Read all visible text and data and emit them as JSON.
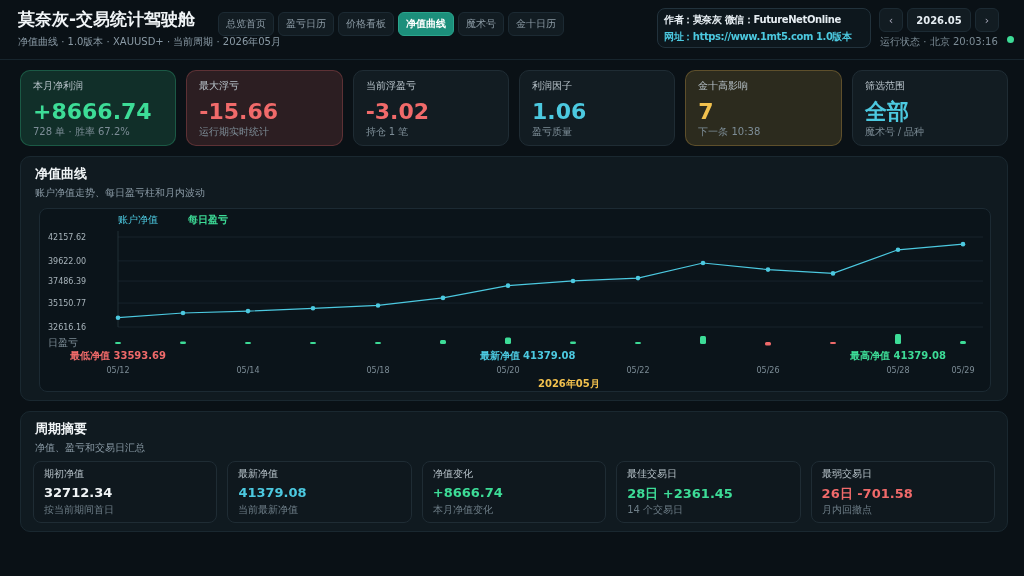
{
  "header": {
    "title": "莫奈灰-交易统计驾驶舱",
    "subtitle": "净值曲线 · 1.0版本 · XAUUSD+ · 当前周期 · 2026年05月",
    "tabs": [
      {
        "label": "总览首页",
        "selected": false
      },
      {
        "label": "盈亏日历",
        "selected": false
      },
      {
        "label": "价格看板",
        "selected": false
      },
      {
        "label": "净值曲线",
        "selected": true
      },
      {
        "label": "魔术号",
        "selected": false
      },
      {
        "label": "金十日历",
        "selected": false
      }
    ],
    "info": {
      "line_1": "作者：莫奈灰  微信：FutureNetOnline",
      "line_2": "网址：https://www.1mt5.com  1.0版本"
    },
    "month": {
      "prev": "‹",
      "value": "2026.05",
      "next": "›",
      "status": "运行状态 · 北京 20:03:16"
    },
    "online": true
  },
  "kpis": [
    {
      "label": "本月净利润",
      "value": "+8666.74",
      "note": "728 单 · 胜率 67.2%",
      "color": "#3ddc97",
      "highlighted": true
    },
    {
      "label": "最大浮亏",
      "value": "-15.66",
      "note": "运行期实时统计",
      "color": "#f06a6a",
      "highlighted": true
    },
    {
      "label": "当前浮盈亏",
      "value": "-3.02",
      "note": "持仓 1 笔",
      "color": "#f06a6a",
      "highlighted": false
    },
    {
      "label": "利润因子",
      "value": "1.06",
      "note": "盈亏质量",
      "color": "#4cc9e0",
      "highlighted": false
    },
    {
      "label": "金十高影响",
      "value": "7",
      "note": "下一条 10:38",
      "color": "#f2c14e",
      "highlighted": true
    },
    {
      "label": "筛选范围",
      "value": "全部",
      "note": "魔术号 / 品种",
      "color": "#4cc9e0",
      "highlighted": false
    }
  ],
  "equity": {
    "title": "净值曲线",
    "subtitle": "账户净值走势、每日盈亏柱和月内波动",
    "bar_legend": {
      "name": "每日盈亏",
      "color": "#3ddc97",
      "axis_label": "日盈亏"
    },
    "chart_data": {
      "type": "line",
      "xlabel": "2026年05月",
      "categories": [
        "05/12",
        null,
        "05/14",
        null,
        "05/18",
        null,
        "05/20",
        null,
        "05/22",
        null,
        "05/26",
        null,
        "05/28",
        "05/29"
      ],
      "ylim": [
        32616.16,
        42157.62
      ],
      "grid": true,
      "yticks": [
        32616.16,
        35150.77,
        37486.39,
        {
          "value": 39622,
          "label": "39622.00"
        },
        42157.62
      ],
      "series": [
        {
          "name": "账户净值",
          "color": "#4cc9e0",
          "values": [
            33600,
            34100,
            34300,
            34600,
            34900,
            35700,
            37000,
            37500,
            37800,
            39400,
            38700,
            38300,
            40800,
            41400
          ]
        }
      ]
    },
    "markers": [
      {
        "text": "最低净值 33593.69",
        "color": "#f06a6a"
      },
      {
        "text": "最新净值 41379.08",
        "color": "#4cc9e0"
      },
      {
        "text": "最高净值 41379.08",
        "color": "#3ddc97"
      }
    ]
  },
  "summary": {
    "title": "周期摘要",
    "subtitle": "净值、盈亏和交易日汇总",
    "cards": [
      {
        "label": "期初净值",
        "value": "32712.34",
        "note": "按当前期间首日",
        "color": "#f1f5f7"
      },
      {
        "label": "最新净值",
        "value": "41379.08",
        "note": "当前最新净值",
        "color": "#4cc9e0"
      },
      {
        "label": "净值变化",
        "value": "+8666.74",
        "note": "本月净值变化",
        "color": "#3ddc97"
      },
      {
        "label": "最佳交易日",
        "value": "28日 +2361.45",
        "note": "14 个交易日",
        "color": "#3ddc97"
      },
      {
        "label": "最弱交易日",
        "value": "26日 -701.58",
        "note": "月内回撤点",
        "color": "#f06a6a"
      }
    ]
  }
}
